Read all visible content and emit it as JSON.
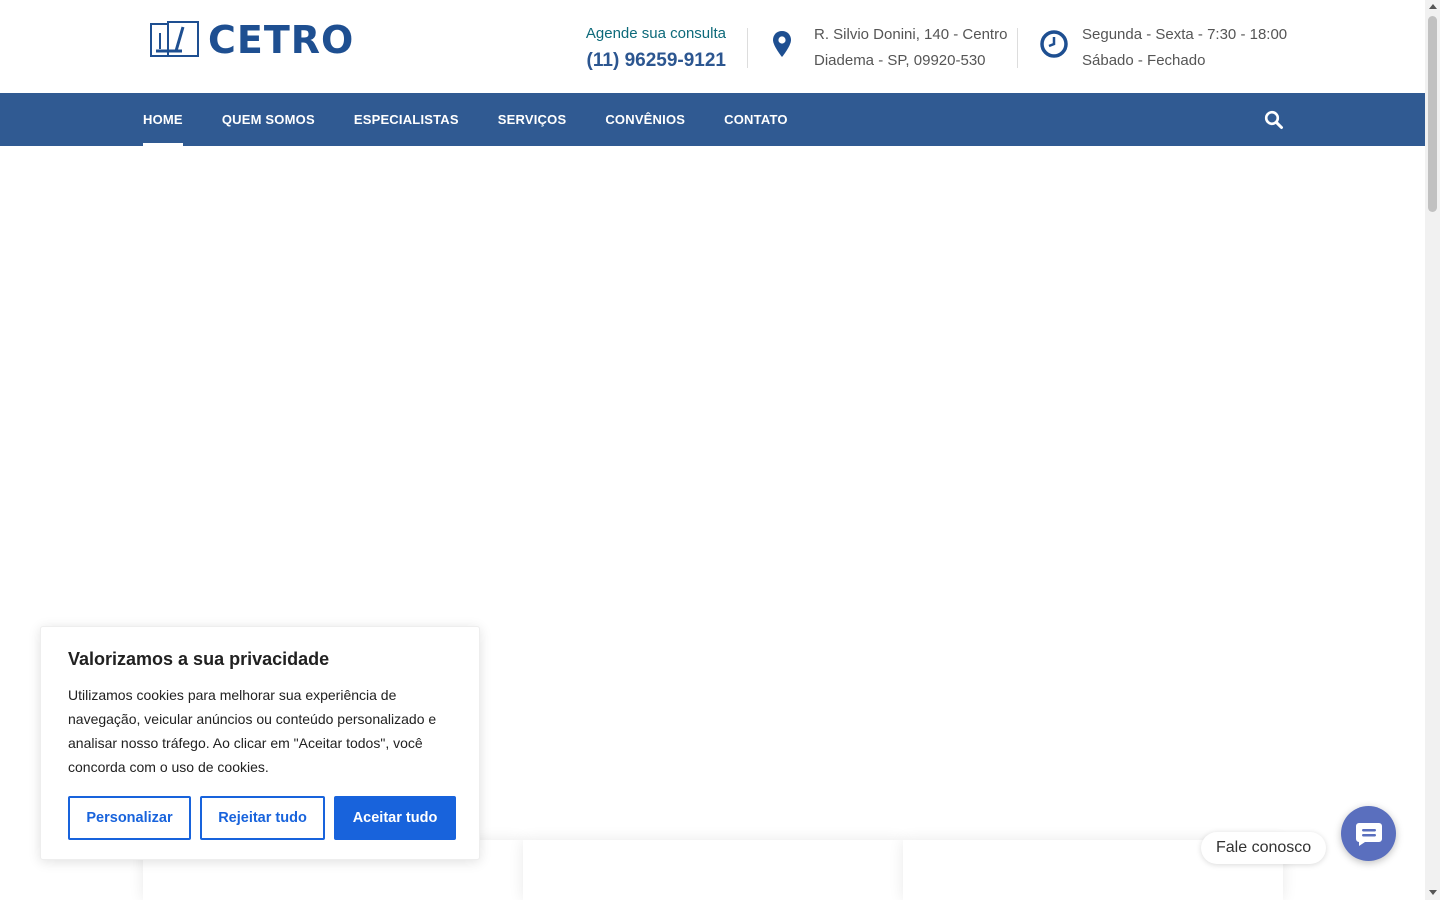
{
  "logo": {
    "text": "CETRO"
  },
  "header": {
    "contact_label": "Agende sua consulta",
    "phone": "(11) 96259-9121",
    "address_line1": "R. Silvio Donini, 140 - Centro",
    "address_line2": "Diadema - SP, 09920-530",
    "hours_line1": "Segunda - Sexta - 7:30 - 18:00",
    "hours_line2": "Sábado - Fechado",
    "location_icon": "map-pin-icon",
    "clock_icon": "clock-icon"
  },
  "nav": {
    "items": [
      {
        "label": "HOME",
        "active": true
      },
      {
        "label": "QUEM SOMOS"
      },
      {
        "label": "ESPECIALISTAS"
      },
      {
        "label": "SERVIÇOS"
      },
      {
        "label": "CONVÊNIOS"
      },
      {
        "label": "CONTATO"
      }
    ],
    "search_icon": "search-icon"
  },
  "cookie": {
    "title": "Valorizamos a sua privacidade",
    "text": "Utilizamos cookies para melhorar sua experiência de navegação, veicular anúncios ou conteúdo personalizado e analisar nosso tráfego. Ao clicar em \"Aceitar todos\", você concorda com o uso de cookies.",
    "btn_customize": "Personalizar",
    "btn_reject": "Rejeitar tudo",
    "btn_accept": "Aceitar tudo"
  },
  "chat": {
    "label": "Fale conosco",
    "icon": "chat-bubble-icon"
  },
  "colors": {
    "brand": "#1e4f91",
    "nav_bg": "#305a92",
    "accent_teal": "#0d6a7a",
    "cookie_blue": "#1863dc",
    "chat_bg": "#5a6fbe"
  }
}
